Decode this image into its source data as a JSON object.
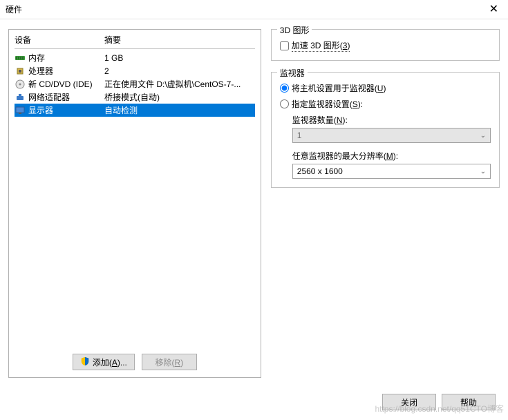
{
  "title": "硬件",
  "columns": {
    "device": "设备",
    "summary": "摘要"
  },
  "devices": [
    {
      "icon": "memory-icon",
      "name": "内存",
      "summary": "1 GB",
      "selected": false
    },
    {
      "icon": "cpu-icon",
      "name": "处理器",
      "summary": "2",
      "selected": false
    },
    {
      "icon": "disc-icon",
      "name": "新 CD/DVD (IDE)",
      "summary": "正在使用文件 D:\\虚拟机\\CentOS-7-...",
      "selected": false
    },
    {
      "icon": "network-icon",
      "name": "网络适配器",
      "summary": "桥接模式(自动)",
      "selected": false
    },
    {
      "icon": "monitor-icon",
      "name": "显示器",
      "summary": "自动检测",
      "selected": true
    }
  ],
  "buttons": {
    "add_label": "添加(",
    "add_hotkey": "A",
    "add_suffix": ")...",
    "remove_label": "移除(",
    "remove_hotkey": "R",
    "remove_suffix": ")",
    "close": "关闭",
    "help": "帮助"
  },
  "group_3d": {
    "legend": "3D 图形",
    "accel_prefix": "加速 3D 图形(",
    "accel_hotkey": "3",
    "accel_suffix": ")",
    "accel_checked": false
  },
  "group_monitor": {
    "legend": "监视器",
    "opt_host_prefix": "将主机设置用于监视器(",
    "opt_host_hotkey": "U",
    "opt_host_suffix": ")",
    "opt_spec_prefix": "指定监视器设置(",
    "opt_spec_hotkey": "S",
    "opt_spec_suffix": "):",
    "count_label_prefix": "监视器数量(",
    "count_hotkey": "N",
    "count_label_suffix": "):",
    "count_value": "1",
    "res_label_prefix": "任意监视器的最大分辨率(",
    "res_hotkey": "M",
    "res_label_suffix": "):",
    "res_value": "2560 x 1600",
    "selected": "host"
  },
  "watermark": "https://blog.csdn.net/qq51CTO博客"
}
